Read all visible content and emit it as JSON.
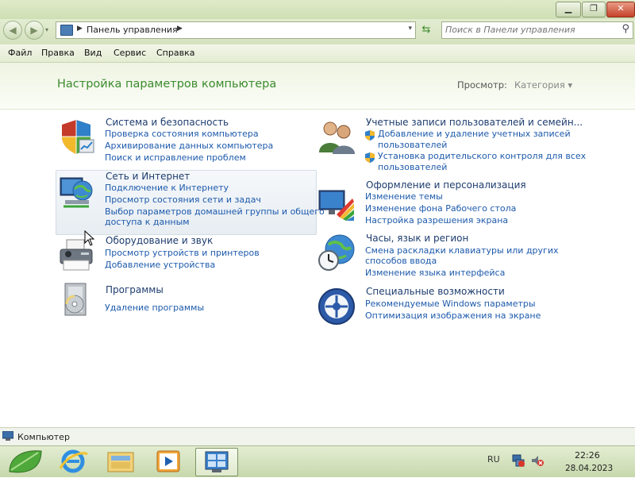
{
  "window": {
    "minimize_glyph": "▁",
    "maximize_glyph": "❐",
    "close_glyph": "✕"
  },
  "address": {
    "back_glyph": "◀",
    "forward_glyph": "▶",
    "breadcrumb": "Панель управления",
    "search_placeholder": "Поиск в Панели управления"
  },
  "menu": {
    "items": [
      "Файл",
      "Правка",
      "Вид",
      "Сервис",
      "Справка"
    ]
  },
  "header": {
    "title": "Настройка параметров компьютера",
    "view_label": "Просмотр:",
    "view_value": "Категория ▾"
  },
  "categories": {
    "system": {
      "title": "Система и безопасность",
      "links": [
        "Проверка состояния компьютера",
        "Архивирование данных компьютера",
        "Поиск и исправление проблем"
      ]
    },
    "network": {
      "title": "Сеть и Интернет",
      "links": [
        "Подключение к Интернету",
        "Просмотр состояния сети и задач",
        "Выбор параметров домашней группы и общего",
        "доступа к данным"
      ]
    },
    "hardware": {
      "title": "Оборудование и звук",
      "links": [
        "Просмотр устройств и принтеров",
        "Добавление устройства"
      ]
    },
    "programs": {
      "title": "Программы",
      "links": [
        "Удаление программы"
      ]
    },
    "accounts": {
      "title": "Учетные записи пользователей и семейн...",
      "links": [
        "Добавление и удаление учетных записей",
        "пользователей",
        "Установка родительского контроля для всех",
        "пользователей"
      ]
    },
    "appearance": {
      "title": "Оформление и персонализация",
      "links": [
        "Изменение темы",
        "Изменение фона Рабочего стола",
        "Настройка разрешения экрана"
      ]
    },
    "clock": {
      "title": "Часы, язык и регион",
      "links": [
        "Смена раскладки клавиатуры или других",
        "способов ввода",
        "Изменение языка интерфейса"
      ]
    },
    "access": {
      "title": "Специальные возможности",
      "links": [
        "Рекомендуемые Windows параметры",
        "Оптимизация изображения на экране"
      ]
    }
  },
  "status": {
    "text": "Компьютер"
  },
  "taskbar": {
    "lang": "RU",
    "time": "22:26",
    "date": "28.04.2023"
  },
  "colors": {
    "title_green": "#3c8a2f",
    "link_blue": "#1d5aab",
    "category_title": "#1e3d6e"
  }
}
